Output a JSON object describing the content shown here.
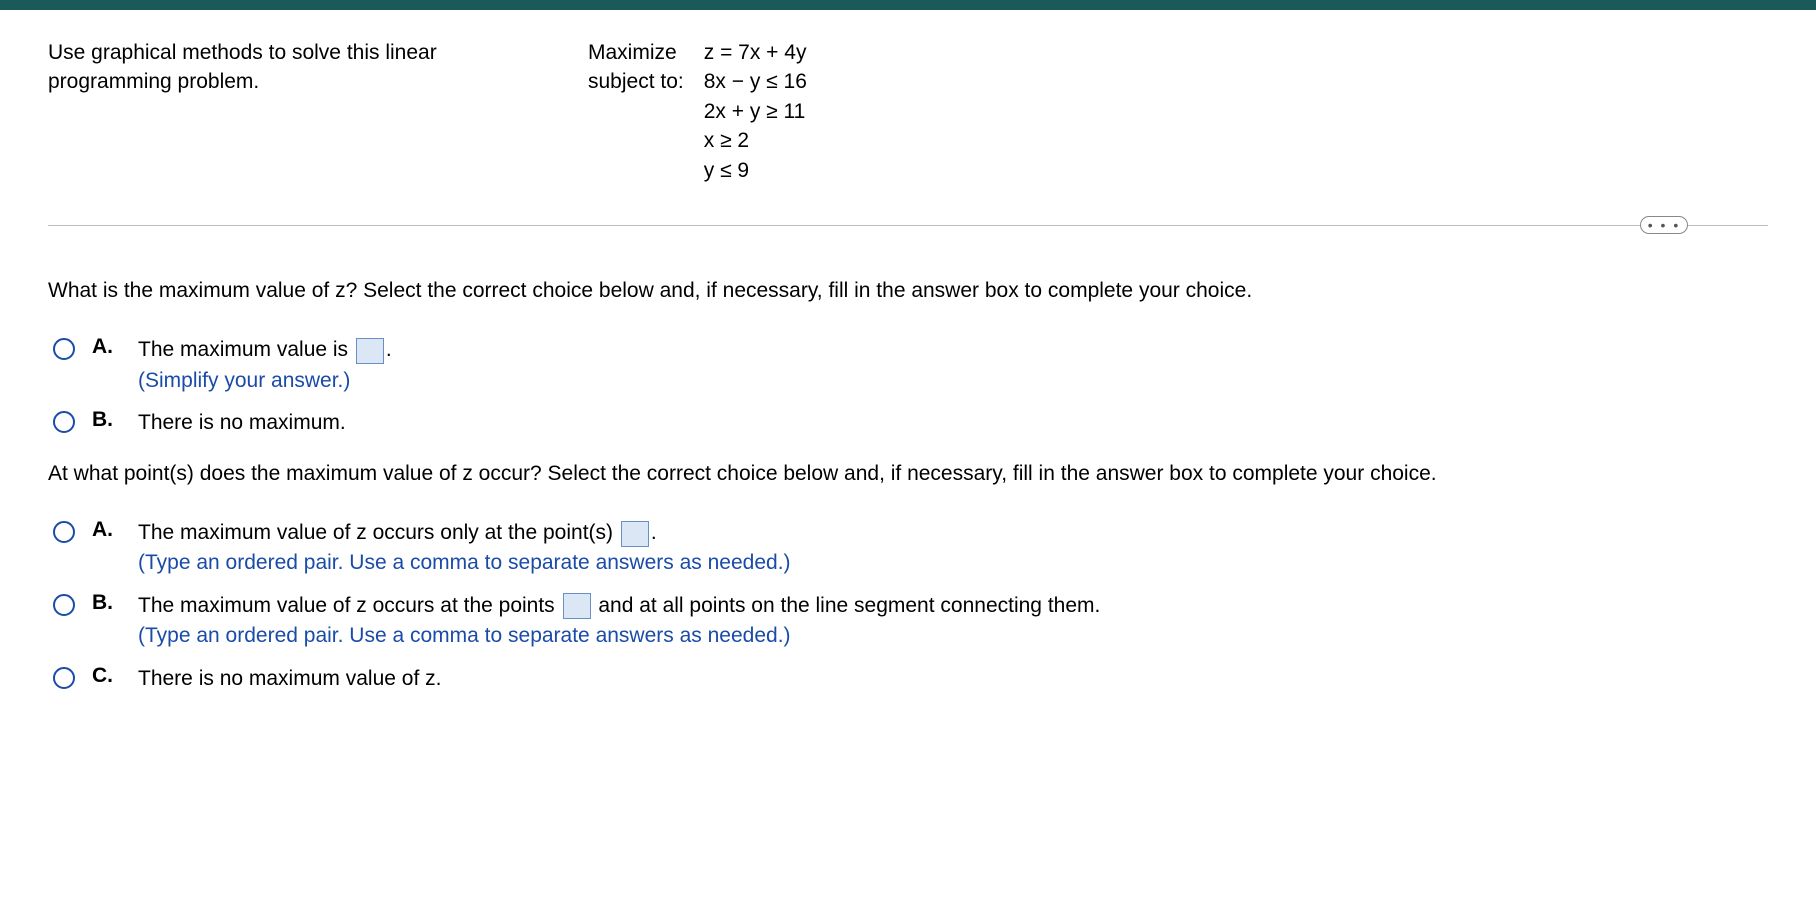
{
  "problem": {
    "instruction": "Use graphical methods to solve this linear programming problem.",
    "maximize_label": "Maximize",
    "subject_label": "subject to:",
    "objective": "z = 7x + 4y",
    "constraints": [
      "8x − y ≤ 16",
      "2x + y ≥ 11",
      "x ≥ 2",
      "y ≤ 9"
    ]
  },
  "more_label": "• • •",
  "q1": {
    "prompt": "What is the maximum value of z? Select the correct choice below and, if necessary, fill in the answer box to complete your choice.",
    "a_letter": "A.",
    "a_text_pre": "The maximum value is ",
    "a_text_post": ".",
    "a_hint": "(Simplify your answer.)",
    "b_letter": "B.",
    "b_text": "There is no maximum."
  },
  "q2": {
    "prompt": "At what point(s) does the maximum value of z occur? Select the correct choice below and, if necessary, fill in the answer box to complete your choice.",
    "a_letter": "A.",
    "a_text_pre": "The maximum value of z occurs only at the point(s) ",
    "a_text_post": ".",
    "a_hint": "(Type an ordered pair. Use a comma to separate answers as needed.)",
    "b_letter": "B.",
    "b_text_pre": "The maximum value of z occurs at the points ",
    "b_text_post": " and at all points on the line segment connecting them.",
    "b_hint": "(Type an ordered pair. Use a comma to separate answers as needed.)",
    "c_letter": "C.",
    "c_text": "There is no maximum value of z."
  }
}
